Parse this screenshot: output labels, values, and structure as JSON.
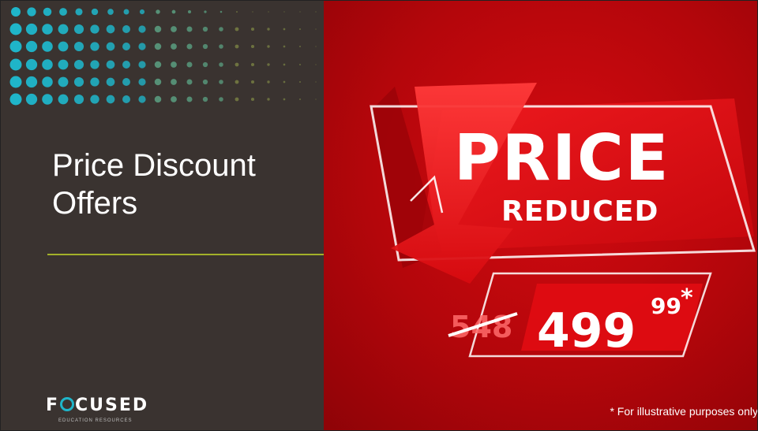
{
  "slide": {
    "title": "Price Discount Offers",
    "logo": {
      "word_before": "F",
      "word_after": "CUSED",
      "tagline": "EDUCATION RESOURCES"
    },
    "banner": {
      "headline": "PRICE",
      "subheadline": "REDUCED",
      "old_price": "548",
      "new_price_main": "499",
      "new_price_cents": "99",
      "asterisk": "*"
    },
    "disclaimer": "* For illustrative purposes only"
  },
  "colors": {
    "left_background": "#3a3330",
    "rule": "#a3b12a",
    "dot_teal": "#1fb5c9",
    "banner_red": "#d40b10"
  }
}
